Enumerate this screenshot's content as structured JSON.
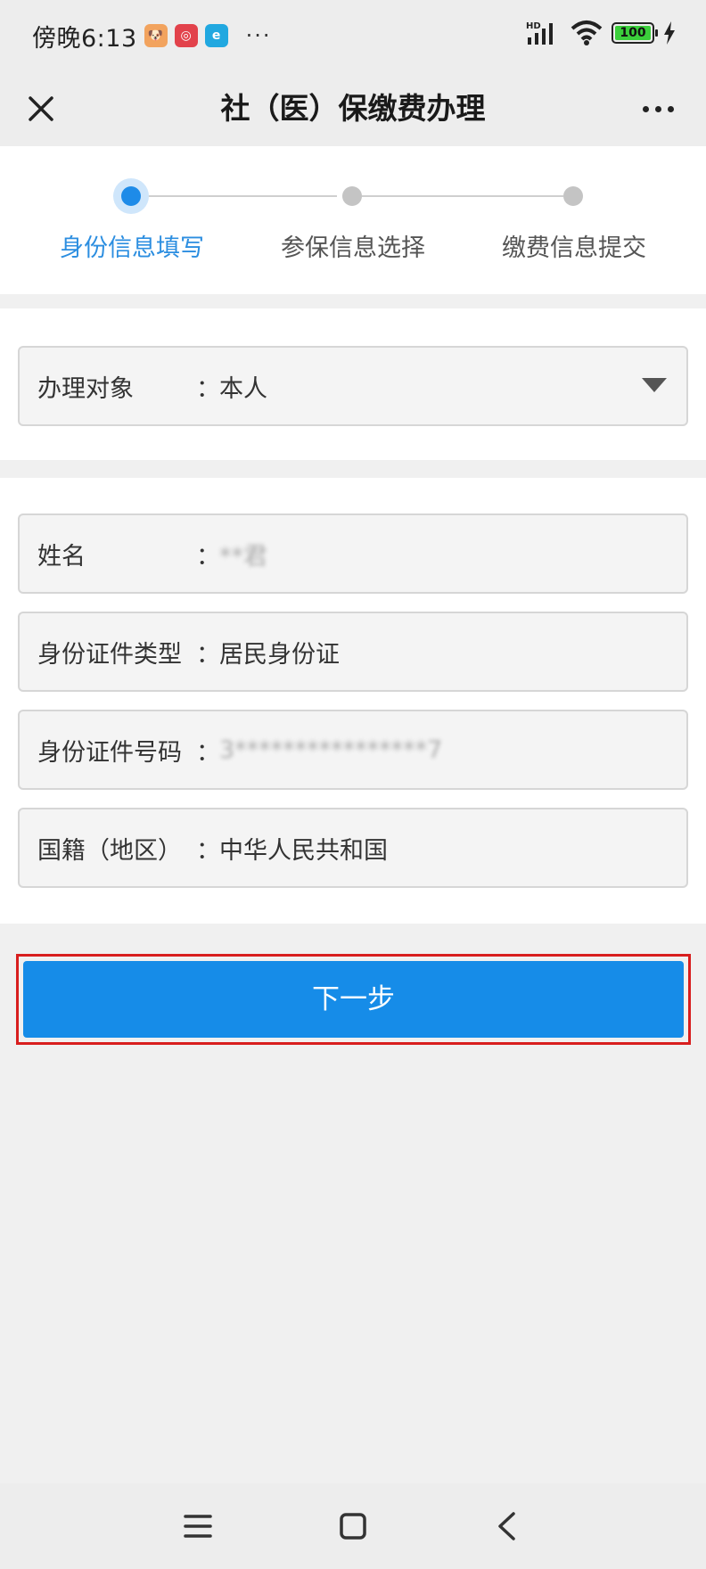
{
  "status_bar": {
    "time": "傍晚6:13",
    "app_icons": [
      "cat-app-icon",
      "red-app-icon",
      "blue-app-icon"
    ],
    "more": "···",
    "network": "HD",
    "battery": "100"
  },
  "header": {
    "title": "社（医）保缴费办理"
  },
  "steps": [
    {
      "label": "身份信息填写",
      "active": true
    },
    {
      "label": "参保信息选择",
      "active": false
    },
    {
      "label": "缴费信息提交",
      "active": false
    }
  ],
  "fields": {
    "object": {
      "label": "办理对象",
      "colon": "：",
      "value": "本人"
    },
    "name": {
      "label": "姓名",
      "colon": "：",
      "value": "**君"
    },
    "id_type": {
      "label": "身份证件类型",
      "colon": "：",
      "value": "居民身份证"
    },
    "id_number": {
      "label": "身份证件号码",
      "colon": "：",
      "value": "3****************7"
    },
    "nationality": {
      "label": "国籍（地区）",
      "colon": "：",
      "value": "中华人民共和国"
    }
  },
  "actions": {
    "next_label": "下一步"
  },
  "colors": {
    "primary": "#168ce8",
    "active_step": "#2c8ee0",
    "highlight_frame": "#d81e1e"
  }
}
